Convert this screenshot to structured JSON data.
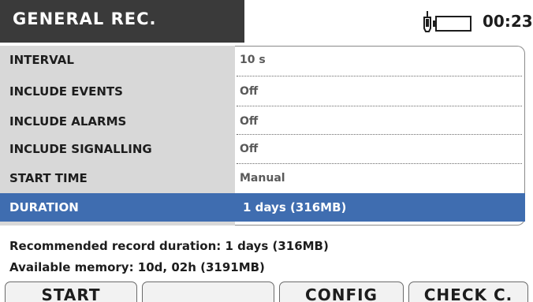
{
  "header": {
    "title": "GENERAL REC.",
    "time": "00:23",
    "icons": [
      "probe-icon",
      "battery-icon"
    ]
  },
  "settings": {
    "rows": [
      {
        "label": "INTERVAL",
        "value": "10 s"
      },
      {
        "label": "INCLUDE EVENTS",
        "value": "Off"
      },
      {
        "label": "INCLUDE ALARMS",
        "value": "Off"
      },
      {
        "label": "INCLUDE SIGNALLING",
        "value": "Off"
      },
      {
        "label": "START TIME",
        "value": "Manual"
      },
      {
        "label": "DURATION",
        "value": "1 days  (316MB)"
      }
    ],
    "selected_row": "DURATION"
  },
  "info": {
    "recommended": "Recommended record duration:  1 days  (316MB)",
    "available": "Available memory: 10d, 02h (3191MB)"
  },
  "softkeys": {
    "key1": "START",
    "key2": "",
    "key3": "CONFIG",
    "key4": "CHECK C."
  },
  "colors": {
    "title_bar": "#3a3a3a",
    "label_column": "#d8d8d8",
    "selection": "#3f6db0"
  }
}
